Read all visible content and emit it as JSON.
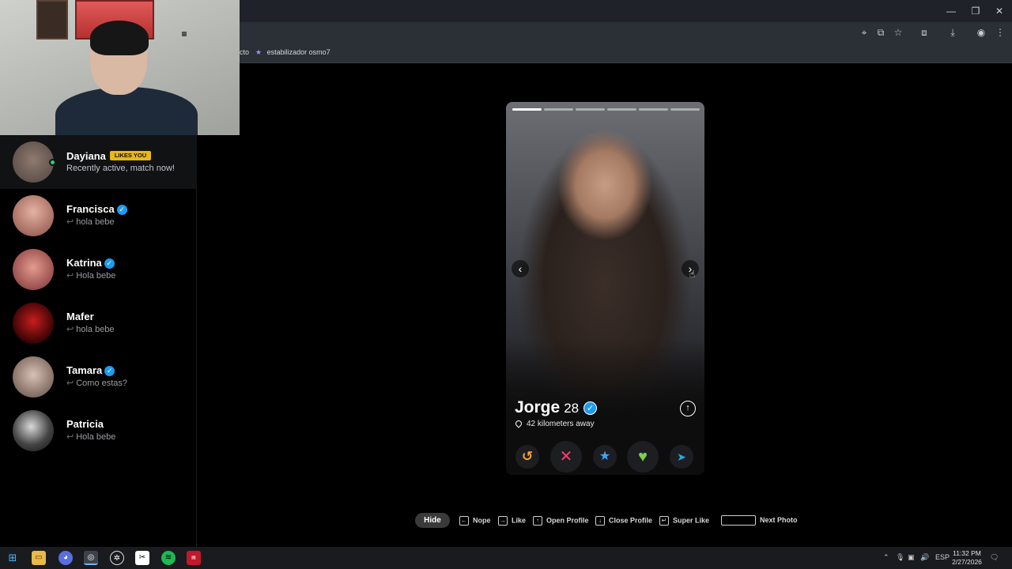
{
  "bookmarks": {
    "partial_left": "cto",
    "item": "estabilizador osmo7"
  },
  "matches": [
    {
      "name": "Dayiana",
      "badge": "LIKES YOU",
      "sub": "Recently active, match now!",
      "verified": false,
      "online": true,
      "avatar_color": "#7e6a60"
    },
    {
      "name": "Francisca",
      "sub": "hola bebe",
      "verified": true,
      "avatar_color": "#c7857a"
    },
    {
      "name": "Katrina",
      "sub": "Hola bebe",
      "verified": true,
      "avatar_color": "#b35a58"
    },
    {
      "name": "Mafer",
      "sub": "hola bebe",
      "verified": false,
      "avatar_color": "#8a0f10"
    },
    {
      "name": "Tamara",
      "sub": "Como estas?",
      "verified": true,
      "avatar_color": "#b59b90"
    },
    {
      "name": "Patricia",
      "sub": "Hola bebe",
      "verified": false,
      "avatar_color": "#3a3a3a"
    }
  ],
  "profile": {
    "name": "Jorge",
    "age": "28",
    "distance": "42 kilometers away",
    "photo_count": 6,
    "current_photo": 1
  },
  "actions": {
    "rewind_icon": "rewind-icon",
    "nope_icon": "nope-icon",
    "superlike_icon": "star-icon",
    "like_icon": "heart-icon",
    "boost_icon": "send-icon",
    "colors": {
      "rewind": "#f5a623",
      "nope": "#fe3c72",
      "superlike": "#3ba8f7",
      "like": "#7bd14a",
      "boost": "#27a9e1"
    }
  },
  "shortcuts": {
    "hide": "Hide",
    "nope": "Nope",
    "like": "Like",
    "open_profile": "Open Profile",
    "close_profile": "Close Profile",
    "super_like": "Super Like",
    "next_photo": "Next Photo"
  },
  "taskbar": {
    "lang": "ESP",
    "time": "11:32 PM",
    "date": "2/27/2026"
  }
}
